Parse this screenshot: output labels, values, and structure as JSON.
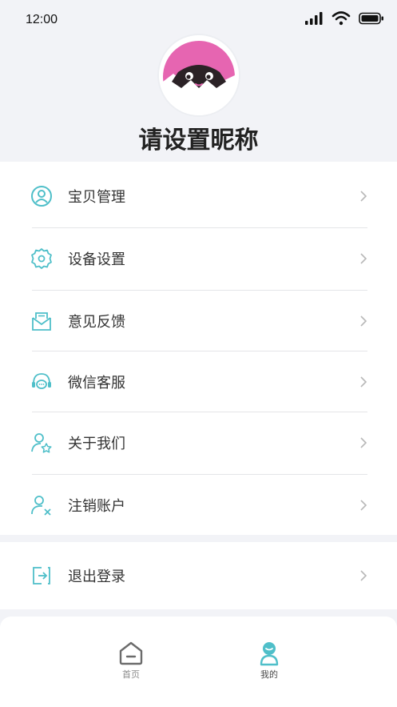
{
  "status_bar": {
    "time": "12:00"
  },
  "profile": {
    "nickname": "请设置昵称"
  },
  "menu": {
    "items": [
      {
        "label": "宝贝管理",
        "icon": "baby-profile-icon"
      },
      {
        "label": "设备设置",
        "icon": "gear-icon"
      },
      {
        "label": "意见反馈",
        "icon": "feedback-envelope-icon"
      },
      {
        "label": "微信客服",
        "icon": "headset-chat-icon"
      },
      {
        "label": "关于我们",
        "icon": "user-star-icon"
      },
      {
        "label": "注销账户",
        "icon": "user-remove-icon"
      }
    ]
  },
  "logout": {
    "label": "退出登录",
    "icon": "exit-icon"
  },
  "tabbar": {
    "tabs": [
      {
        "label": "首页",
        "icon": "home-icon"
      },
      {
        "label": "我的",
        "icon": "profile-icon",
        "active": true
      }
    ]
  },
  "colors": {
    "accent": "#4fbfc9",
    "avatar_pink": "#e665b1",
    "text": "#333333",
    "muted": "#8a8a8a"
  }
}
